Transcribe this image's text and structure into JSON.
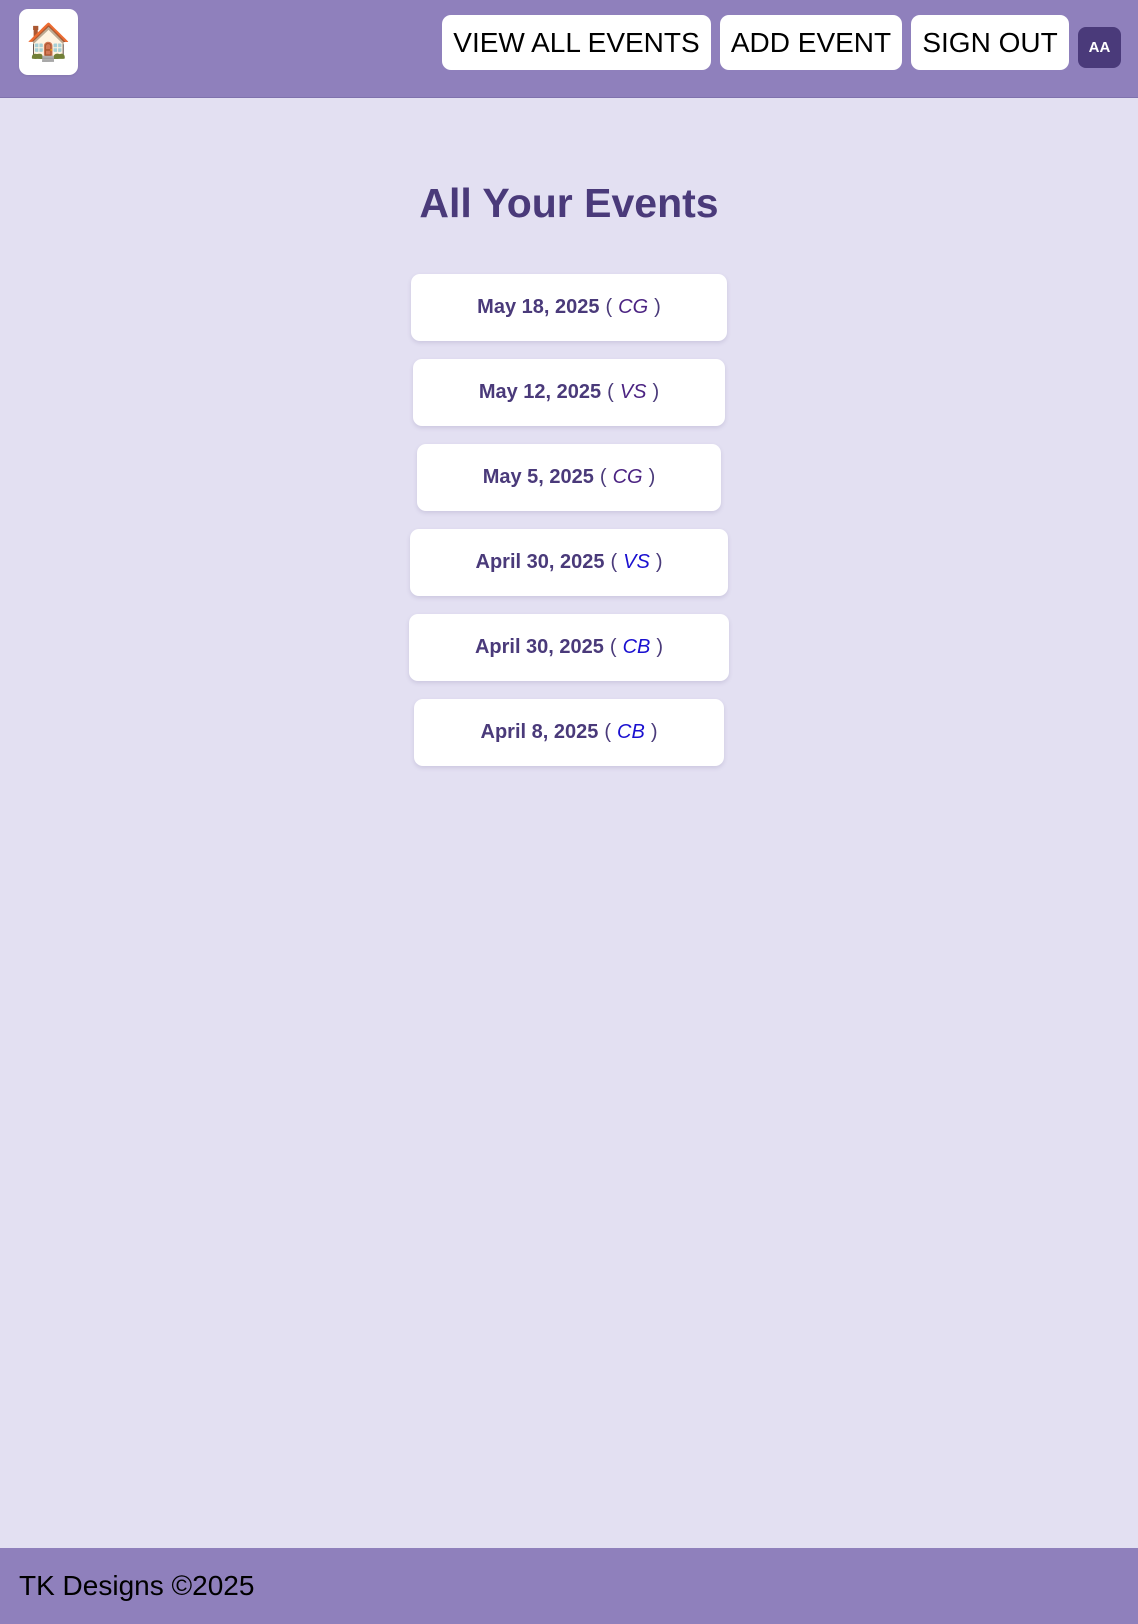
{
  "header": {
    "home_icon": "🏠",
    "nav": [
      {
        "label": "VIEW ALL EVENTS"
      },
      {
        "label": "ADD EVENT"
      },
      {
        "label": "SIGN OUT"
      }
    ],
    "avatar_initials": "AA"
  },
  "main": {
    "title": "All Your Events",
    "events": [
      {
        "date": "May 18, 2025",
        "open": "(",
        "code": "CG",
        "close": ")",
        "code_color": "#4b2382"
      },
      {
        "date": "May 12, 2025",
        "open": "(",
        "code": "VS",
        "close": ")",
        "code_color": "#4b2382"
      },
      {
        "date": "May 5, 2025",
        "open": "(",
        "code": "CG",
        "close": ")",
        "code_color": "#4b2382"
      },
      {
        "date": "April 30, 2025",
        "open": "(",
        "code": "VS",
        "close": ")",
        "code_color": "#1a10d0"
      },
      {
        "date": "April 30, 2025",
        "open": "(",
        "code": "CB",
        "close": ")",
        "code_color": "#1a10d0"
      },
      {
        "date": "April 8, 2025",
        "open": "(",
        "code": "CB",
        "close": ")",
        "code_color": "#1a10d0"
      }
    ]
  },
  "footer": {
    "text": "TK Designs ©2025"
  },
  "colors": {
    "header_bg": "#8f80bc",
    "page_bg": "#e3e0f2",
    "accent": "#4a3a7a"
  }
}
